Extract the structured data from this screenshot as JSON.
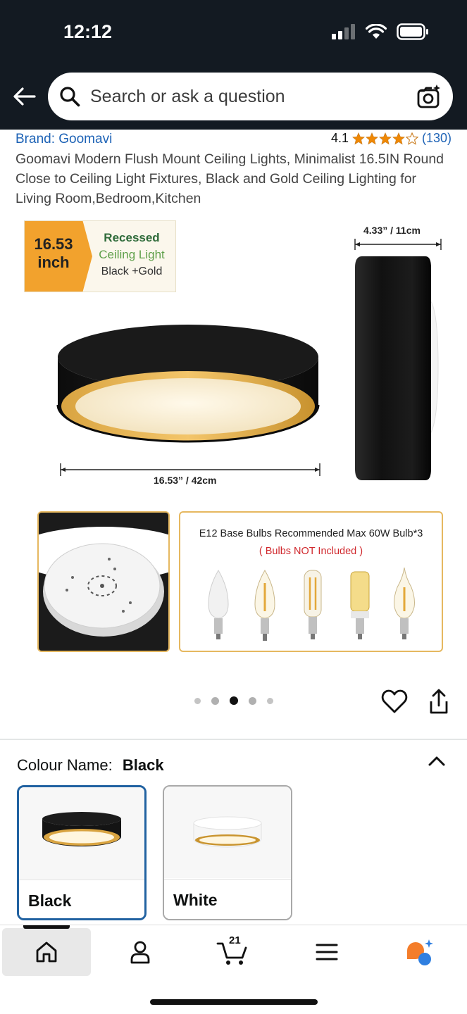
{
  "status_bar": {
    "time": "12:12"
  },
  "search": {
    "placeholder": "Search or ask a question"
  },
  "product": {
    "brand": "Brand: Goomavi",
    "rating": "4.1",
    "rating_stars": 4.1,
    "review_count": "(130)",
    "title": "Goomavi Modern Flush Mount Ceiling Lights, Minimalist 16.5IN Round Close to Ceiling Light Fixtures, Black and Gold Ceiling Lighting for Living Room,Bedroom,Kitchen"
  },
  "gallery": {
    "badge": {
      "size_line1": "16.53",
      "size_line2": "inch",
      "line1": "Recessed",
      "line2": "Ceiling Light",
      "line3": "Black +Gold"
    },
    "height_label": "4.33” / 11cm",
    "width_label": "16.53” / 42cm",
    "bulb_title": "E12 Base Bulbs Recommended Max 60W Bulb*3",
    "bulb_note": "( Bulbs NOT Included )",
    "page_count": 5,
    "active_page": 3
  },
  "colour": {
    "label": "Colour Name:",
    "selected": "Black",
    "options": [
      {
        "label": "Black"
      },
      {
        "label": "White"
      }
    ]
  },
  "bottom_nav": {
    "cart_count": "21"
  },
  "colors": {
    "header_bg": "#131a22",
    "link": "#1e63b6",
    "star": "#f08804",
    "selected_border": "#2162a1",
    "badge_orange": "#f2a22d"
  }
}
